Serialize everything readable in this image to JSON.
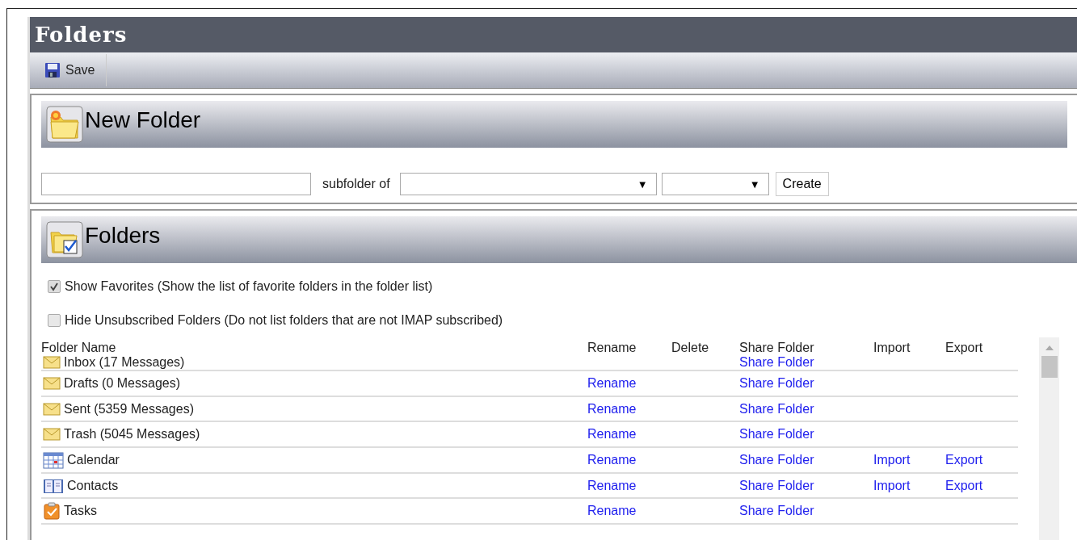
{
  "page": {
    "title": "Folders"
  },
  "toolbar": {
    "save_label": "Save"
  },
  "new_folder": {
    "title": "New Folder",
    "subfolder_label": "subfolder of",
    "parent_arrow": "▼",
    "type_arrow": "▼",
    "create_label": "Create"
  },
  "folders": {
    "title": "Folders",
    "options": [
      {
        "label": "Show Favorites (Show the list of favorite folders in the folder list)",
        "checked": true
      },
      {
        "label": "Hide Unsubscribed Folders (Do not list folders that are not IMAP subscribed)",
        "checked": false
      }
    ],
    "columns": [
      "Folder Name",
      "Rename",
      "Delete",
      "Share Folder",
      "Import",
      "Export"
    ],
    "rows": [
      {
        "kind": "mail",
        "name": "Inbox (17 Messages)",
        "share": "Share Folder"
      },
      {
        "kind": "mail",
        "name": "Drafts (0 Messages)",
        "rename": "Rename",
        "share": "Share Folder"
      },
      {
        "kind": "mail",
        "name": "Sent (5359 Messages)",
        "rename": "Rename",
        "share": "Share Folder"
      },
      {
        "kind": "mail",
        "name": "Trash (5045 Messages)",
        "rename": "Rename",
        "share": "Share Folder"
      },
      {
        "kind": "calendar",
        "name": "Calendar",
        "rename": "Rename",
        "share": "Share Folder",
        "import": "Import",
        "export": "Export"
      },
      {
        "kind": "contacts",
        "name": "Contacts",
        "rename": "Rename",
        "share": "Share Folder",
        "import": "Import",
        "export": "Export"
      },
      {
        "kind": "tasks",
        "name": "Tasks",
        "rename": "Rename",
        "share": "Share Folder"
      }
    ]
  }
}
